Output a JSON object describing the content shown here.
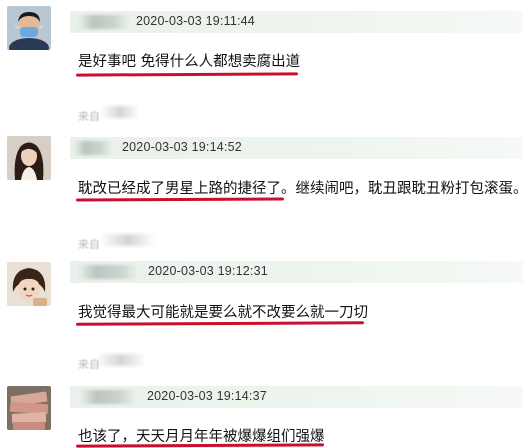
{
  "comments": [
    {
      "timestamp": "2020-03-03 19:11:44",
      "text": "是好事吧 免得什么人都想卖腐出道",
      "source": "来自"
    },
    {
      "timestamp": "2020-03-03 19:14:52",
      "text": "耽改已经成了男星上路的捷径了。继续闹吧，耽丑跟耽丑粉打包滚蛋。",
      "source": "来自"
    },
    {
      "timestamp": "2020-03-03 19:12:31",
      "text": "我觉得最大可能就是要么就不改要么就一刀切",
      "source": "来自"
    },
    {
      "timestamp": "2020-03-03 19:14:37",
      "text": "也该了，天天月月年年被爆爆组们强爆",
      "source": ""
    }
  ],
  "colors": {
    "underline": "#c8102e",
    "meta_bg": "#eef5ee"
  },
  "icons": [
    "avatar-masked-man",
    "avatar-woman-long-hair",
    "avatar-child",
    "avatar-banknotes"
  ]
}
